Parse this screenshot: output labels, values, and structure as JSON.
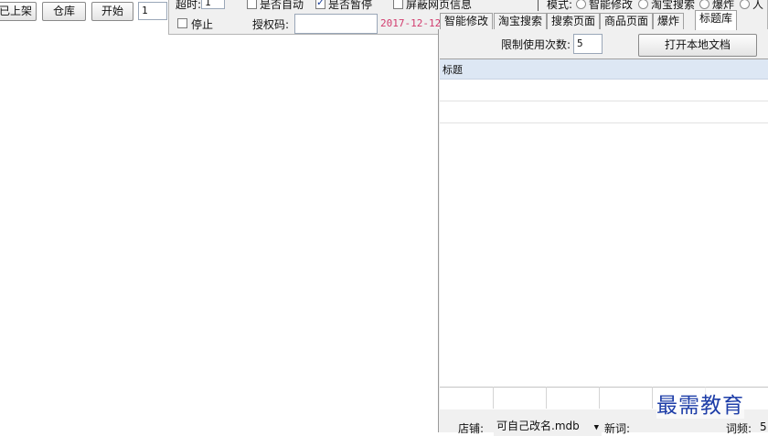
{
  "toolbar": {
    "listed_button": "已上架",
    "warehouse_button": "仓库",
    "start_button": "开始",
    "count_value": "1"
  },
  "settings": {
    "delay_label": "超时:",
    "delay_value": "1",
    "auto_label": "是否自动",
    "pause_label": "是否暂停",
    "block_label": "屏蔽网页信息",
    "mode_label": "模式:",
    "mode_options": [
      "智能修改",
      "淘宝搜索",
      "爆炸",
      "人"
    ],
    "stop_label": "停止",
    "auth_label": "授权码:",
    "auth_value": "",
    "date_text": "2017-12-12"
  },
  "tabs": [
    "智能修改",
    "淘宝搜索",
    "搜索页面",
    "商品页面",
    "爆炸",
    "标题库"
  ],
  "panel": {
    "limit_label": "限制使用次数:",
    "limit_value": "5",
    "open_doc_button": "打开本地文档",
    "column_header": "标题"
  },
  "statusbar": {
    "shop_label": "店铺:",
    "shop_value": "可自己改名.mdb",
    "newword_label": "新词:",
    "freq_label": "词频:",
    "freq_value": "5"
  },
  "watermark": "最需教育",
  "colors": {
    "date_pink": "#d23c6e",
    "header_blue": "#dde7f4",
    "panel_bg": "#f0f0f0"
  }
}
